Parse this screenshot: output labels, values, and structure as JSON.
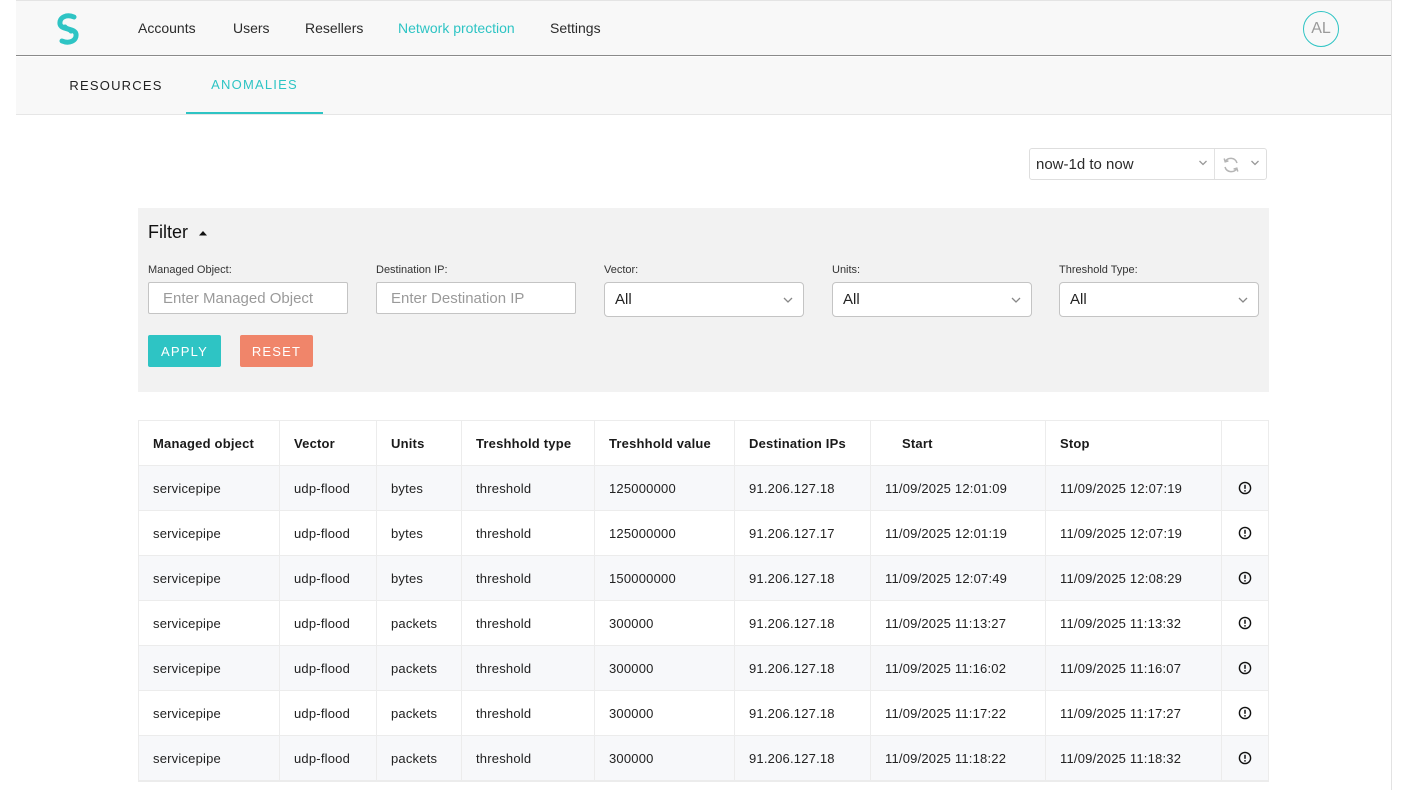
{
  "nav": {
    "items": [
      {
        "label": "Accounts",
        "active": false
      },
      {
        "label": "Users",
        "active": false
      },
      {
        "label": "Resellers",
        "active": false
      },
      {
        "label": "Network protection",
        "active": true
      },
      {
        "label": "Settings",
        "active": false
      }
    ],
    "avatar_initials": "AL"
  },
  "subtabs": [
    {
      "label": "RESOURCES",
      "active": false
    },
    {
      "label": "ANOMALIES",
      "active": true
    }
  ],
  "time_range": {
    "value": "now-1d to now"
  },
  "filter": {
    "title": "Filter",
    "fields": {
      "managed_object": {
        "label": "Managed Object:",
        "placeholder": "Enter Managed Object",
        "value": ""
      },
      "destination_ip": {
        "label": "Destination IP:",
        "placeholder": "Enter Destination IP",
        "value": ""
      },
      "vector": {
        "label": "Vector:",
        "value": "All"
      },
      "units": {
        "label": "Units:",
        "value": "All"
      },
      "threshold_type": {
        "label": "Threshold Type:",
        "value": "All"
      }
    },
    "apply_label": "APPLY",
    "reset_label": "RESET"
  },
  "table": {
    "columns": [
      "Managed object",
      "Vector",
      "Units",
      "Treshhold type",
      "Treshhold value",
      "Destination IPs",
      "Start",
      "Stop",
      ""
    ],
    "rows": [
      [
        "servicepipe",
        "udp-flood",
        "bytes",
        "threshold",
        "125000000",
        "91.206.127.18",
        "11/09/2025 12:01:09",
        "11/09/2025 12:07:19"
      ],
      [
        "servicepipe",
        "udp-flood",
        "bytes",
        "threshold",
        "125000000",
        "91.206.127.17",
        "11/09/2025 12:01:19",
        "11/09/2025 12:07:19"
      ],
      [
        "servicepipe",
        "udp-flood",
        "bytes",
        "threshold",
        "150000000",
        "91.206.127.18",
        "11/09/2025 12:07:49",
        "11/09/2025 12:08:29"
      ],
      [
        "servicepipe",
        "udp-flood",
        "packets",
        "threshold",
        "300000",
        "91.206.127.18",
        "11/09/2025 11:13:27",
        "11/09/2025 11:13:32"
      ],
      [
        "servicepipe",
        "udp-flood",
        "packets",
        "threshold",
        "300000",
        "91.206.127.18",
        "11/09/2025 11:16:02",
        "11/09/2025 11:16:07"
      ],
      [
        "servicepipe",
        "udp-flood",
        "packets",
        "threshold",
        "300000",
        "91.206.127.18",
        "11/09/2025 11:17:22",
        "11/09/2025 11:17:27"
      ],
      [
        "servicepipe",
        "udp-flood",
        "packets",
        "threshold",
        "300000",
        "91.206.127.18",
        "11/09/2025 11:18:22",
        "11/09/2025 11:18:32"
      ]
    ]
  },
  "colors": {
    "accent": "#2ec4c4",
    "reset": "#f0856a"
  },
  "icons": {
    "logo": "brand-logo-icon",
    "refresh": "refresh-icon",
    "chevron": "chevron-down-icon",
    "caret": "caret-up-icon",
    "row_action": "info-icon"
  }
}
